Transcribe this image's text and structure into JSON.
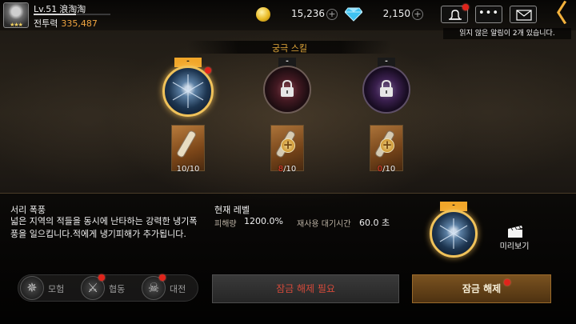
{
  "player": {
    "level": "Lv.51",
    "name": "浪淘淘",
    "power_label": "전투력",
    "power_value": "335,487",
    "xp_fraction": 0.55
  },
  "currency": {
    "gold": "15,236",
    "gems": "2,150"
  },
  "topbar": {
    "menu_glyph": "•••",
    "back_glyph": "〈"
  },
  "notification_text": "읽지 않은 알림이 2개 있습니다.",
  "section_title": "궁극 스킬",
  "skills": [
    {
      "tag": "-",
      "locked": false,
      "selected": true,
      "card_have": "10",
      "card_need": "10",
      "enough": true
    },
    {
      "tag": "-",
      "locked": true,
      "selected": false,
      "card_have": "8",
      "card_need": "10",
      "enough": false
    },
    {
      "tag": "-",
      "locked": true,
      "selected": false,
      "card_have": "0",
      "card_need": "10",
      "enough": false
    }
  ],
  "detail": {
    "skill_name": "서리 폭풍",
    "description": "넓은 지역의 적들을 동시에 난타하는 강력한 냉기폭풍을 일으킵니다.적에게 냉기피해가 추가됩니다.",
    "current_level_label": "현재 레벨",
    "damage_label": "피해량",
    "damage_value": "1200.0%",
    "cooldown_label": "재사용 대기시간",
    "cooldown_value": "60.0 초",
    "orb_tag": "-",
    "preview_label": "미리보기"
  },
  "modes": [
    {
      "label": "모험",
      "icon": "compass-icon",
      "badge": false
    },
    {
      "label": "협동",
      "icon": "crossed-swords-icon",
      "badge": true
    },
    {
      "label": "대전",
      "icon": "skull-icon",
      "badge": true
    }
  ],
  "buttons": {
    "unlock_needed": "잠금 해제 필요",
    "unlock": "잠금 해제"
  },
  "colors": {
    "accent_gold": "#f1a62a",
    "power_orange": "#f2a641",
    "alert_red": "#e0241b",
    "section_title": "#e4a93a"
  }
}
